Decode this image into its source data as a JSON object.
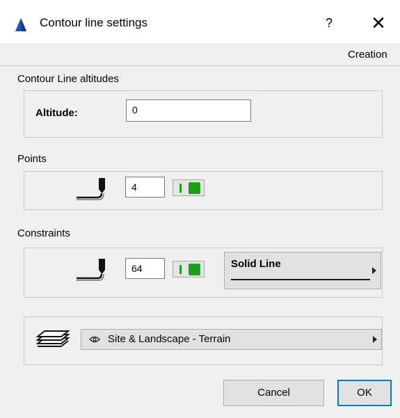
{
  "window": {
    "title": "Contour line settings",
    "help_label": "?",
    "close_label": "✕"
  },
  "header": {
    "mode_label": "Creation"
  },
  "altitudes": {
    "section_title": "Contour Line altitudes",
    "altitude_label": "Altitude:",
    "altitude_value": "0"
  },
  "points": {
    "section_title": "Points",
    "pen_value": "4"
  },
  "constraints": {
    "section_title": "Constraints",
    "pen_value": "64",
    "line_type": "Solid Line"
  },
  "layer": {
    "name": "Site & Landscape - Terrain"
  },
  "buttons": {
    "cancel": "Cancel",
    "ok": "OK"
  },
  "colors": {
    "accent": "#0078d7",
    "pen_green": "#19a319"
  },
  "icons": [
    "app-icon",
    "help-icon",
    "close-icon",
    "pen-icon",
    "eye-icon",
    "layer-stack-icon",
    "chevron-right-icon"
  ]
}
